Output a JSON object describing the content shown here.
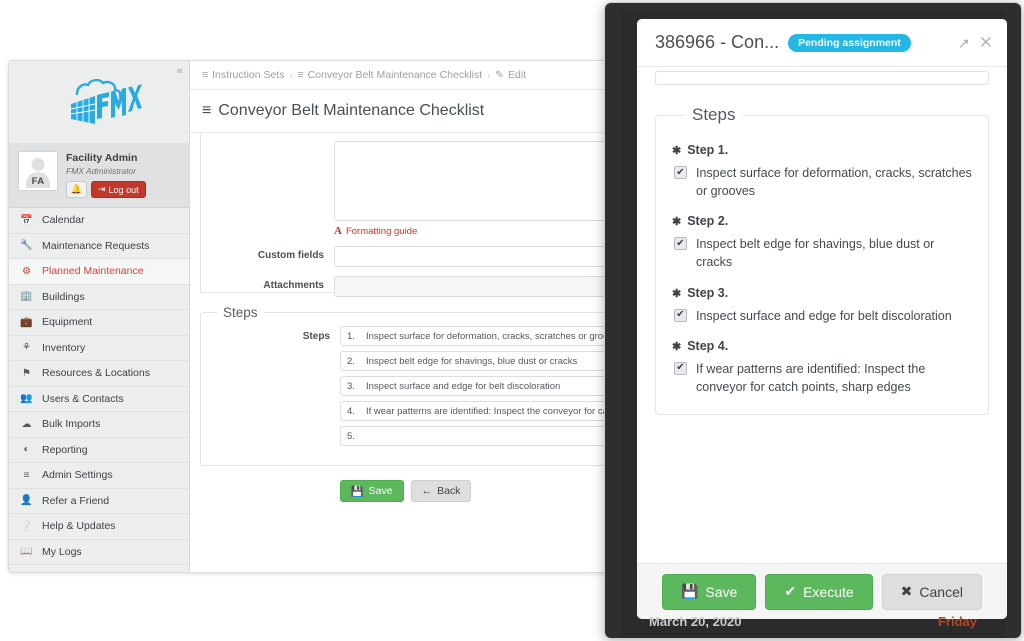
{
  "app": {
    "sidebar": {
      "collapse_icon": "chevron-double-left",
      "logo_text": "FMX",
      "profile": {
        "initials": "FA",
        "name": "Facility Admin",
        "role": "FMX Administrator",
        "bell_icon": "bell-icon",
        "logout_label": "Log out"
      },
      "items": [
        {
          "label": "Calendar",
          "icon": "calendar-icon",
          "active": false
        },
        {
          "label": "Maintenance Requests",
          "icon": "wrench-icon",
          "active": false
        },
        {
          "label": "Planned Maintenance",
          "icon": "gears-icon",
          "active": true
        },
        {
          "label": "Buildings",
          "icon": "building-icon",
          "active": false
        },
        {
          "label": "Equipment",
          "icon": "toolbox-icon",
          "active": false
        },
        {
          "label": "Inventory",
          "icon": "boxes-icon",
          "active": false
        },
        {
          "label": "Resources & Locations",
          "icon": "flag-icon",
          "active": false
        },
        {
          "label": "Users & Contacts",
          "icon": "users-icon",
          "active": false
        },
        {
          "label": "Bulk Imports",
          "icon": "cloud-upload-icon",
          "active": false
        },
        {
          "label": "Reporting",
          "icon": "pie-chart-icon",
          "active": false
        },
        {
          "label": "Admin Settings",
          "icon": "sliders-icon",
          "active": false
        },
        {
          "label": "Refer a Friend",
          "icon": "user-plus-icon",
          "active": false
        },
        {
          "label": "Help & Updates",
          "icon": "question-circle-icon",
          "active": false
        },
        {
          "label": "My Logs",
          "icon": "book-icon",
          "active": false
        }
      ]
    },
    "breadcrumb": [
      {
        "label": "Instruction Sets",
        "icon": "list-icon"
      },
      {
        "label": "Conveyor Belt Maintenance Checklist",
        "icon": "list-icon"
      },
      {
        "label": "Edit",
        "icon": "pencil-square-icon"
      }
    ],
    "breadcrumb_separator": "›",
    "page_title": "Conveyor Belt Maintenance Checklist",
    "form": {
      "formatting_guide_label": "Formatting guide",
      "custom_fields_label": "Custom fields",
      "attachments_label": "Attachments"
    },
    "steps_section": {
      "legend": "Steps",
      "field_label": "Steps",
      "rows": [
        {
          "num": "1.",
          "text": "Inspect surface for deformation, cracks, scratches or grooves"
        },
        {
          "num": "2.",
          "text": "Inspect belt edge for shavings, blue dust or cracks"
        },
        {
          "num": "3.",
          "text": "Inspect surface and edge for belt discoloration"
        },
        {
          "num": "4.",
          "text": "If wear patterns are identified: Inspect the conveyor for catch poi"
        },
        {
          "num": "5.",
          "text": ""
        }
      ]
    },
    "actions": {
      "save_label": "Save",
      "save_icon": "floppy-disk-icon",
      "back_label": "Back",
      "back_icon": "arrow-left-icon"
    }
  },
  "modal": {
    "title": "386966 - Con...",
    "badge": "Pending assignment",
    "popout_icon": "external-link-icon",
    "close_icon": "close-icon",
    "steps_legend": "Steps",
    "steps": [
      {
        "heading": "Step 1.",
        "checked": true,
        "text": "Inspect surface for deformation, cracks, scratches or grooves"
      },
      {
        "heading": "Step 2.",
        "checked": true,
        "text": "Inspect belt edge for shavings, blue dust or cracks"
      },
      {
        "heading": "Step 3.",
        "checked": true,
        "text": "Inspect surface and edge for belt discoloration"
      },
      {
        "heading": "Step 4.",
        "checked": true,
        "text": "If wear patterns are identified: Inspect the conveyor for catch points, sharp edges"
      }
    ],
    "required_marker": "✱",
    "check_mark": "✔",
    "footer": {
      "save_label": "Save",
      "save_icon": "floppy-disk-icon",
      "execute_label": "Execute",
      "execute_icon": "check-icon",
      "cancel_label": "Cancel",
      "cancel_icon": "close-icon"
    },
    "bottom_bar": {
      "date": "March 20, 2020",
      "day": "Friday"
    }
  },
  "colors": {
    "accent_red": "#d1442f",
    "badge_cyan": "#23b7e5",
    "green": "#5cb85c",
    "logout_red": "#c0392b",
    "logo_cyan": "#29abe2",
    "modal_chrome": "#2b2b2b"
  }
}
